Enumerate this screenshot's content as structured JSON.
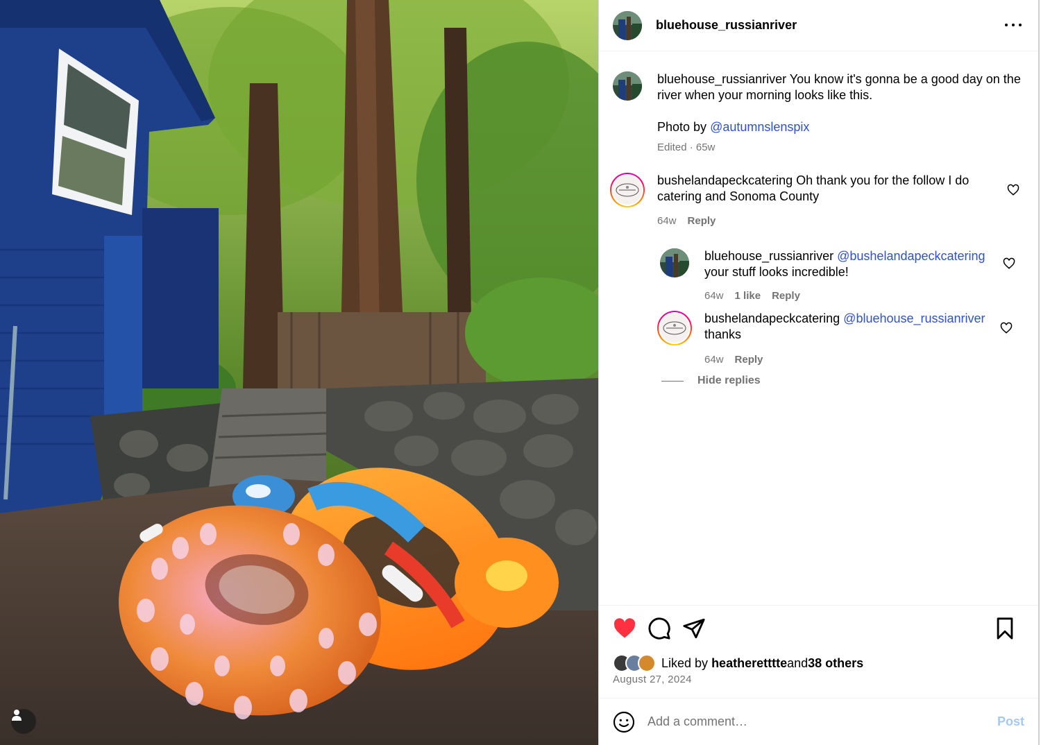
{
  "post": {
    "author": "bluehouse_russianriver",
    "caption_text": "You know it's gonna be a good day on the river when your morning looks like this.",
    "credit_prefix": "Photo by ",
    "credit_mention": "@autumnslenspix",
    "caption_meta": "Edited · 65w"
  },
  "comments": [
    {
      "user": "bushelandapeckcatering",
      "text": "Oh thank you for the follow I do catering and Sonoma County",
      "time": "64w",
      "reply_label": "Reply"
    }
  ],
  "replies": [
    {
      "user": "bluehouse_russianriver",
      "mention": "@bushelandapeckcatering",
      "text": "your stuff looks incredible!",
      "time": "64w",
      "likes": "1 like",
      "reply_label": "Reply"
    },
    {
      "user": "bushelandapeckcatering",
      "mention": "@bluehouse_russianriver",
      "text": "thanks",
      "time": "64w",
      "reply_label": "Reply"
    }
  ],
  "hide_replies_label": "Hide replies",
  "likes": {
    "prefix": "Liked by ",
    "first_liker": "heatheretttte",
    "middle": " and ",
    "others": "38 others"
  },
  "date": "August 27, 2024",
  "comment_box": {
    "placeholder": "Add a comment…",
    "post_label": "Post"
  },
  "icons": {
    "like": "heart-filled-icon",
    "comment": "comment-icon",
    "share": "share-icon",
    "save": "bookmark-icon",
    "emoji": "emoji-icon",
    "more": "more-horizontal-icon",
    "user_tag": "user-tag-icon"
  },
  "colors": {
    "like_red": "#ff3040",
    "mention_blue": "#2f4fd6",
    "muted": "#737373",
    "post_disabled": "#a6c8f6"
  }
}
